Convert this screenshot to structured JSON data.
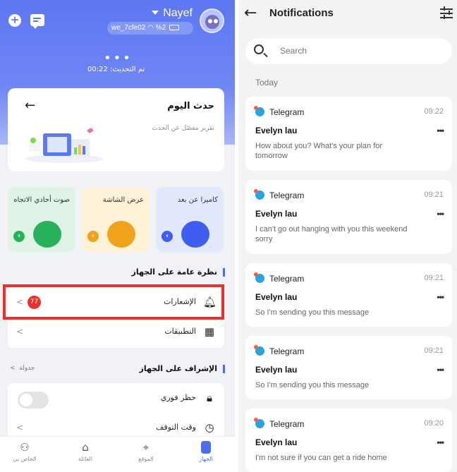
{
  "left": {
    "header": {
      "user_name": "Nayef",
      "device_id": "we_7cfe02",
      "battery": "%2",
      "last_update": "تم التحديث: 00:22"
    },
    "report": {
      "title": "حدث اليوم",
      "subtitle": "تقرير مفصّل عن الحدث"
    },
    "tiles": [
      {
        "label": "كاميرا عن بعد",
        "bg": "#e3e9fc",
        "accent": "#3f5ef0"
      },
      {
        "label": "عرض الشاشة",
        "bg": "#fdf1d8",
        "accent": "#f0a31a"
      },
      {
        "label": "صوت أحادي الاتجاه",
        "bg": "#dff3e6",
        "accent": "#27b15a"
      }
    ],
    "overview": {
      "title": "نظرة عامة على الجهاز",
      "rows": [
        {
          "label": "الإشعارات",
          "badge": "77",
          "icon": "bell-icon"
        },
        {
          "label": "التطبيقات",
          "icon": "apps-grid-icon"
        }
      ]
    },
    "supervision": {
      "title": "الإشراف على الجهاز",
      "link": "جدولة",
      "rows": [
        {
          "label": "حظر فوري",
          "icon": "lock-icon"
        },
        {
          "label": "وقت التوقف",
          "icon": "clock-icon"
        }
      ]
    },
    "tabs": [
      {
        "label": "الخاص بي",
        "icon": "person-icon"
      },
      {
        "label": "العائلة",
        "icon": "home-icon"
      },
      {
        "label": "الموقع",
        "icon": "location-icon"
      },
      {
        "label": "الجهاز",
        "icon": "phone-icon"
      }
    ],
    "accent": "#4e6cf0",
    "alert": "#e8312d"
  },
  "right": {
    "title": "Notifications",
    "search_placeholder": "Search",
    "section": "Today",
    "notifications": [
      {
        "app": "Telegram",
        "time": "09:22",
        "sender": "Evelyn lau",
        "body": "How about you? What's your plan for tomorrow"
      },
      {
        "app": "Telegram",
        "time": "09:21",
        "sender": "Evelyn lau",
        "body": "I can't go out hanging with you this weekend sorry"
      },
      {
        "app": "Telegram",
        "time": "09:21",
        "sender": "Evelyn lau",
        "body": "So I'm sending you this message"
      },
      {
        "app": "Telegram",
        "time": "09:21",
        "sender": "Evelyn lau",
        "body": "So I'm sending you this message"
      },
      {
        "app": "Telegram",
        "time": "09:20",
        "sender": "Evelyn lau",
        "body": "I'm not sure if you can get a ride home"
      }
    ]
  }
}
